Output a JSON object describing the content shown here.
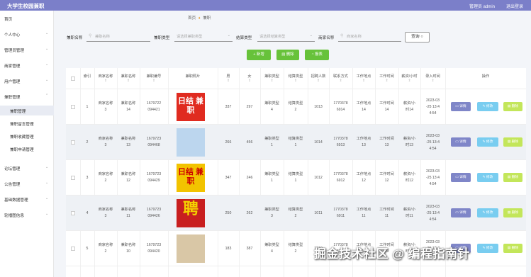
{
  "topbar": {
    "title": "大学生校园兼职",
    "user": "管理员 admin",
    "logout": "退出登录"
  },
  "sidebar": {
    "items": [
      {
        "label": "首页",
        "arrow": ""
      },
      {
        "label": "个人中心",
        "arrow": "⌄"
      },
      {
        "label": "管理员管理",
        "arrow": "⌄"
      },
      {
        "label": "商家管理",
        "arrow": "⌄"
      },
      {
        "label": "用户管理",
        "arrow": "⌄"
      },
      {
        "label": "兼职管理",
        "arrow": "⌃"
      },
      {
        "label": "兼职管理",
        "arrow": ""
      },
      {
        "label": "兼职留言管理",
        "arrow": ""
      },
      {
        "label": "兼职收藏管理",
        "arrow": ""
      },
      {
        "label": "兼职申请管理",
        "arrow": ""
      },
      {
        "label": "论坛管理",
        "arrow": "⌄"
      },
      {
        "label": "公告管理",
        "arrow": "⌄"
      },
      {
        "label": "基础数据管理",
        "arrow": "⌄"
      },
      {
        "label": "轮播图信息",
        "arrow": "⌄"
      }
    ]
  },
  "breadcrumb": {
    "home": "首页",
    "current": "兼职"
  },
  "filters": {
    "f1_label": "兼职名称",
    "f1_placeholder": "兼职名称",
    "f2_label": "兼职类型",
    "f2_placeholder": "请选择兼职类型",
    "f3_label": "结算类型",
    "f3_placeholder": "请选择结算类型",
    "f4_label": "商家名称",
    "f4_placeholder": "商家名称",
    "search": "查询"
  },
  "actions": {
    "add": "新增",
    "delete": "删除",
    "report": "报表"
  },
  "table": {
    "headers": [
      "索引",
      "商家名称",
      "兼职名称",
      "兼职编号",
      "兼职照片",
      "男",
      "女",
      "兼职类型",
      "结算类型",
      "招聘人数",
      "联系方式",
      "工作地点",
      "工作时间",
      "薪资/小时",
      "录入时间",
      "操作"
    ],
    "sort_glyph": "⇕",
    "row_buttons": {
      "detail": "详情",
      "edit": "修改",
      "delete": "删除"
    },
    "rows": [
      {
        "idx": "1",
        "shop": [
          "商家名称",
          "3"
        ],
        "name": [
          "兼职名称",
          "14"
        ],
        "code": [
          "1679722",
          "094421"
        ],
        "male": "337",
        "female": "297",
        "jtype": [
          "兼职类型",
          "4"
        ],
        "stype": [
          "结算类型",
          "2"
        ],
        "count": "1013",
        "phone": [
          "1770378",
          "6914"
        ],
        "place": [
          "工作地点",
          "14"
        ],
        "time": [
          "工作时间",
          "14"
        ],
        "pay": [
          "薪资/小",
          "时14"
        ],
        "date": [
          "2023-03",
          "-25 13:4",
          "4:54"
        ]
      },
      {
        "idx": "2",
        "shop": [
          "商家名称",
          "3"
        ],
        "name": [
          "兼职名称",
          "13"
        ],
        "code": [
          "1679723",
          "094468"
        ],
        "male": "266",
        "female": "456",
        "jtype": [
          "兼职类型",
          "1"
        ],
        "stype": [
          "结算类型",
          "1"
        ],
        "count": "1014",
        "phone": [
          "1770378",
          "6913"
        ],
        "place": [
          "工作地点",
          "13"
        ],
        "time": [
          "工作时间",
          "13"
        ],
        "pay": [
          "薪资/小",
          "时13"
        ],
        "date": [
          "2023-03",
          "-25 13:4",
          "4:54"
        ]
      },
      {
        "idx": "3",
        "shop": [
          "商家名称",
          "2"
        ],
        "name": [
          "兼职名称",
          "12"
        ],
        "code": [
          "1679723",
          "094429"
        ],
        "male": "347",
        "female": "246",
        "jtype": [
          "兼职类型",
          "1"
        ],
        "stype": [
          "结算类型",
          "1"
        ],
        "count": "1012",
        "phone": [
          "1770378",
          "6912"
        ],
        "place": [
          "工作地点",
          "12"
        ],
        "time": [
          "工作时间",
          "12"
        ],
        "pay": [
          "薪资/小",
          "时12"
        ],
        "date": [
          "2023-03",
          "-25 13:4",
          "4:54"
        ]
      },
      {
        "idx": "4",
        "shop": [
          "商家名称",
          "3"
        ],
        "name": [
          "兼职名称",
          "11"
        ],
        "code": [
          "1679723",
          "094426"
        ],
        "male": "250",
        "female": "262",
        "jtype": [
          "兼职类型",
          "3"
        ],
        "stype": [
          "结算类型",
          "2"
        ],
        "count": "1011",
        "phone": [
          "1770378",
          "6911"
        ],
        "place": [
          "工作地点",
          "11"
        ],
        "time": [
          "工作时间",
          "11"
        ],
        "pay": [
          "薪资/小",
          "时11"
        ],
        "date": [
          "2023-03",
          "-25 13:4",
          "4:54"
        ]
      },
      {
        "idx": "5",
        "shop": [
          "商家名称",
          "2"
        ],
        "name": [
          "兼职名称",
          "10"
        ],
        "code": [
          "1679723",
          "094420"
        ],
        "male": "183",
        "female": "387",
        "jtype": [
          "兼职类型",
          "4"
        ],
        "stype": [
          "结算类型",
          "2"
        ],
        "count": "1010",
        "phone": [
          "1770378",
          "6910"
        ],
        "place": [
          "工作地点",
          "10"
        ],
        "time": [
          "工作时间",
          "10"
        ],
        "pay": [
          "薪资/小",
          "时10"
        ],
        "date": [
          "2023-03",
          "-25 13:4",
          "4:54"
        ]
      }
    ]
  },
  "posters": [
    {
      "text": "日结 兼职",
      "bg": "#e02b20"
    },
    {
      "text": "",
      "bg": "#bcd6ee"
    },
    {
      "text": "日结 兼职",
      "bg": "#f2c300"
    },
    {
      "text": "聘",
      "bg": "#c81f1f"
    },
    {
      "text": "",
      "bg": "#d9c7a6"
    }
  ],
  "watermark": "掘金技术社区 @ 编程指南针",
  "colors": {
    "topbar": "#7b7fc9",
    "detail": "#7f86c8",
    "edit": "#79cdf0",
    "delete": "#c3e65a",
    "green": "#67c23a"
  }
}
